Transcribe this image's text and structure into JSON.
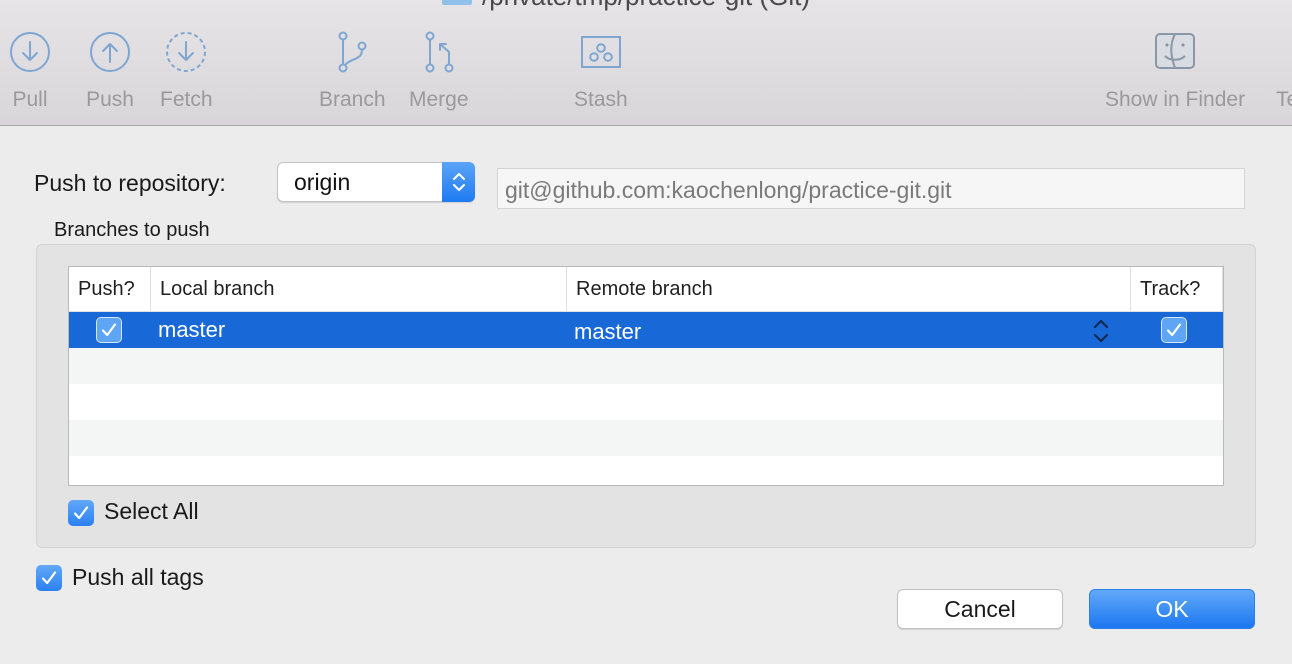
{
  "window": {
    "title": "/private/tmp/practice-git (Git)"
  },
  "toolbar": {
    "items": [
      {
        "label": "Pull",
        "icon": "pull-icon"
      },
      {
        "label": "Push",
        "icon": "push-icon"
      },
      {
        "label": "Fetch",
        "icon": "fetch-icon"
      },
      {
        "label": "Branch",
        "icon": "branch-icon"
      },
      {
        "label": "Merge",
        "icon": "merge-icon"
      },
      {
        "label": "Stash",
        "icon": "stash-icon"
      },
      {
        "label": "Show in Finder",
        "icon": "finder-icon"
      },
      {
        "label": "Te",
        "icon": ""
      }
    ]
  },
  "dialog": {
    "repo_label": "Push to repository:",
    "repo_value": "origin",
    "repo_url": "git@github.com:kaochenlong/practice-git.git",
    "branches_label": "Branches to push",
    "columns": {
      "push": "Push?",
      "local": "Local branch",
      "remote": "Remote branch",
      "track": "Track?"
    },
    "rows": [
      {
        "push": true,
        "local": "master",
        "remote": "master",
        "track": true
      }
    ],
    "select_all_label": "Select All",
    "select_all_checked": true,
    "push_tags_label": "Push all tags",
    "push_tags_checked": true,
    "cancel_label": "Cancel",
    "ok_label": "OK"
  },
  "colors": {
    "accent": "#1f7af2",
    "selection": "#1868d8",
    "toolbar_icon": "#7fa6d3"
  }
}
